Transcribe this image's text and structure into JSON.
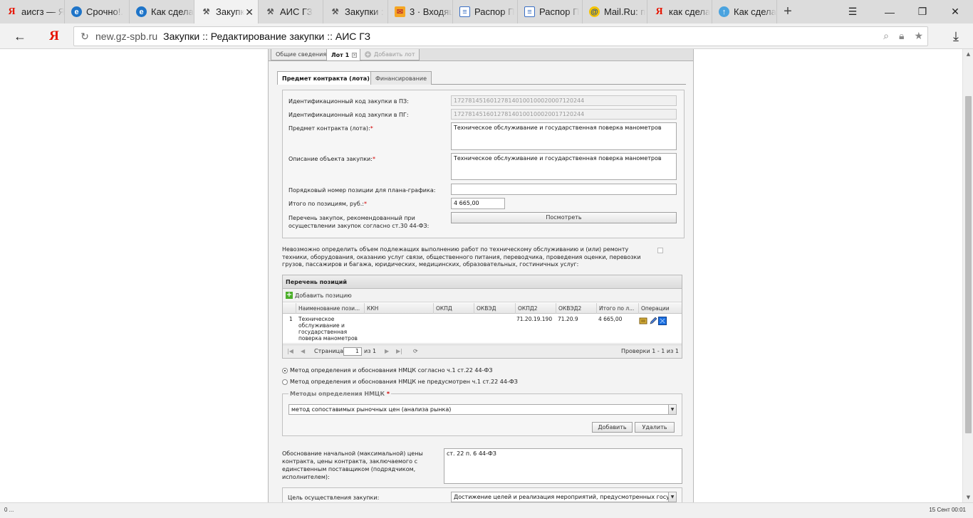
{
  "browser": {
    "tabs": [
      {
        "label": "аисгз — Я",
        "icon": "yandex-icon"
      },
      {
        "label": "Срочно!.",
        "icon": "ie-icon"
      },
      {
        "label": "Как сдела",
        "icon": "ie-icon"
      },
      {
        "label": "Закупк",
        "icon": "hammer-icon",
        "active": true
      },
      {
        "label": "АИС ГЗ",
        "icon": "hammer-icon"
      },
      {
        "label": "Закупки :",
        "icon": "hammer-icon"
      },
      {
        "label": "3 · Входящ",
        "icon": "mail-icon"
      },
      {
        "label": "Распор П",
        "icon": "doc-icon"
      },
      {
        "label": "Распор П",
        "icon": "doc-icon"
      },
      {
        "label": "Mail.Ru: п",
        "icon": "at-icon"
      },
      {
        "label": "как сдела",
        "icon": "yandex-icon"
      },
      {
        "label": "Как сдела",
        "icon": "up-icon"
      }
    ],
    "address_domain": "new.gz-spb.ru",
    "address_title": "Закупки :: Редактирование закупки :: АИС ГЗ"
  },
  "lot_tabs": {
    "general": "Общие сведения",
    "lot1": "Лот 1",
    "add_lot": "Добавить лот"
  },
  "sub_tabs": {
    "subject": "Предмет контракта (лота)",
    "finance": "Финансирование"
  },
  "form": {
    "id_pz_label": "Идентификационный код закупки в ПЗ:",
    "id_pz_value": "172781451601278140100100020007120244",
    "id_pg_label": "Идентификационный код закупки в ПГ:",
    "id_pg_value": "172781451601278140100100020017120244",
    "subject_label": "Предмет контракта (лота):",
    "subject_value": "Техническое обслуживание и государственная поверка манометров",
    "desc_label": "Описание объекта закупки:",
    "desc_value": "Техническое обслуживание и государственная поверка манометров",
    "position_no_label": "Порядковый номер позиции для плана-графика:",
    "position_no_value": "",
    "total_label": "Итого по позициям, руб.:",
    "total_value": "4 665,00",
    "list_label_1": "Перечень закупок, рекомендованный при",
    "list_label_2": "осуществлении закупок согласно ст.30 44-ФЗ:",
    "view_button": "Посмотреть",
    "required_mark": "*"
  },
  "note": "Невозможно определить объем подлежащих выполнению работ по техническому обслуживанию и (или) ремонту техники, оборудования, оказанию услуг связи, общественного питания, переводчика, проведения оценки, перевозки грузов, пассажиров и багажа, юридических, медицинских, образовательных, гостиничных услуг:",
  "grid": {
    "title": "Перечень позиций",
    "add_position": "Добавить позицию",
    "columns": [
      "Наименование пози...",
      "ККН",
      "ОКПД",
      "ОКВЭД",
      "ОКПД2",
      "ОКВЭД2",
      "Итого по л...",
      "Операции"
    ],
    "rows": [
      {
        "num": "1",
        "name_1": "Техническое",
        "name_2": "обслуживание и",
        "name_3": "государственная",
        "name_4": "поверка манометров",
        "kkn": "",
        "okpd": "",
        "okved": "",
        "okpd2": "71.20.19.190",
        "okved2": "71.20.9",
        "total": "4 665,00"
      }
    ],
    "pager": {
      "page_label": "Страница",
      "page_value": "1",
      "of_label": "из 1",
      "records": "Проверки 1 - 1 из 1"
    }
  },
  "method": {
    "radio_1": "Метод определения и обоснования НМЦК согласно ч.1 ст.22 44-ФЗ",
    "radio_2": "Метод определения и обоснования НМЦК не предусмотрен ч.1 ст.22 44-ФЗ",
    "group_title": "Методы определения НМЦК",
    "selected": "метод сопоставимых рыночных цен (анализа рынка)",
    "add_button": "Добавить",
    "delete_button": "Удалить"
  },
  "justification": {
    "label_1": "Обоснование начальной (максимальной) цены",
    "label_2": "контракта, цены контракта, заключаемого с",
    "label_3": "единственным поставщиком (подрядчиком,",
    "label_4": "исполнителем):",
    "value": "ст. 22 п. 6 44-ФЗ"
  },
  "goal": {
    "label": "Цель осуществления закупки:",
    "value": "Достижение целей и реализация мероприятий, предусмотренных госуд"
  },
  "status": {
    "left": "0 ...",
    "right": "15 Сент 00:01"
  }
}
